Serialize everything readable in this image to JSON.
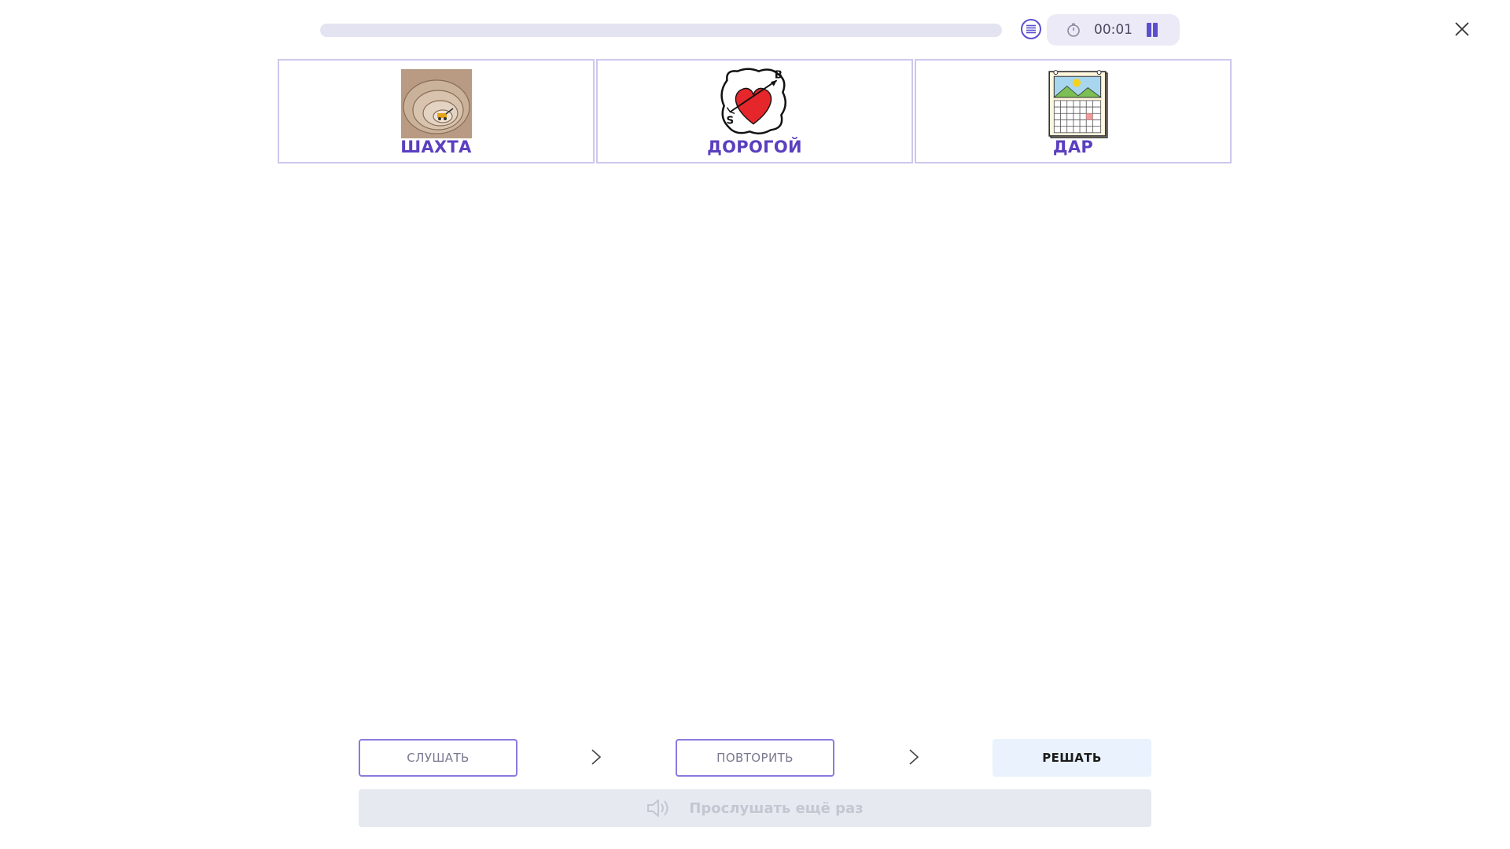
{
  "progress": {
    "value": 0
  },
  "timer": {
    "time": "00:01"
  },
  "cards": [
    {
      "label": "ШАХТА",
      "icon": "quarry-mine-icon"
    },
    {
      "label": "ДОРОГОЙ",
      "icon": "heart-arrow-icon",
      "sign_letters": [
        "B",
        "S"
      ]
    },
    {
      "label": "ДАР",
      "icon": "calendar-icon"
    }
  ],
  "steps": {
    "listen": "СЛУШАТЬ",
    "repeat": "ПОВТОРИТЬ",
    "solve": "РЕШАТЬ"
  },
  "listen_again": {
    "label": "Прослушать ещё раз",
    "icon": "speaker-icon"
  },
  "colors": {
    "accent": "#5b4fd0",
    "card_label": "#5b3fbf",
    "card_border": "#ccc8ec",
    "solve_bg": "#e9f2fd",
    "disabled_bg": "#e6e9ef"
  }
}
